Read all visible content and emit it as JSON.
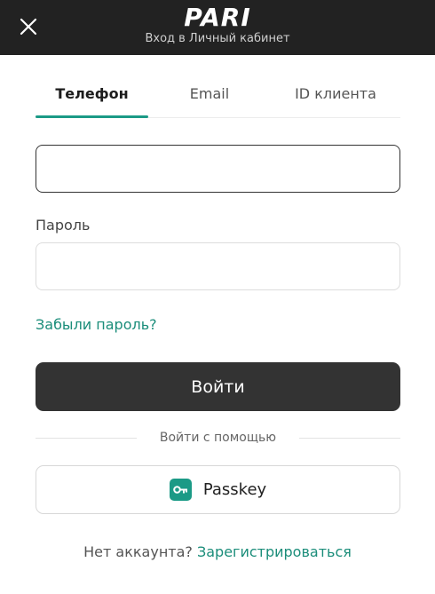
{
  "header": {
    "logo_text": "PARI",
    "subtitle": "Вход в Личный кабинет",
    "close_icon": "close-icon"
  },
  "tabs": [
    {
      "label": "Телефон",
      "active": true
    },
    {
      "label": "Email",
      "active": false
    },
    {
      "label": "ID клиента",
      "active": false
    }
  ],
  "form": {
    "phone_value": "",
    "password_label": "Пароль",
    "password_value": "",
    "forgot_link": "Забыли пароль?",
    "login_button": "Войти",
    "divider_text": "Войти с помощью",
    "passkey_button": "Passkey",
    "passkey_icon": "key-icon"
  },
  "footer": {
    "question": "Нет аккаунта?",
    "register_link": "Зарегистрироваться"
  },
  "colors": {
    "header_bg": "#222222",
    "accent": "#1b9a86",
    "primary_button": "#333333"
  }
}
